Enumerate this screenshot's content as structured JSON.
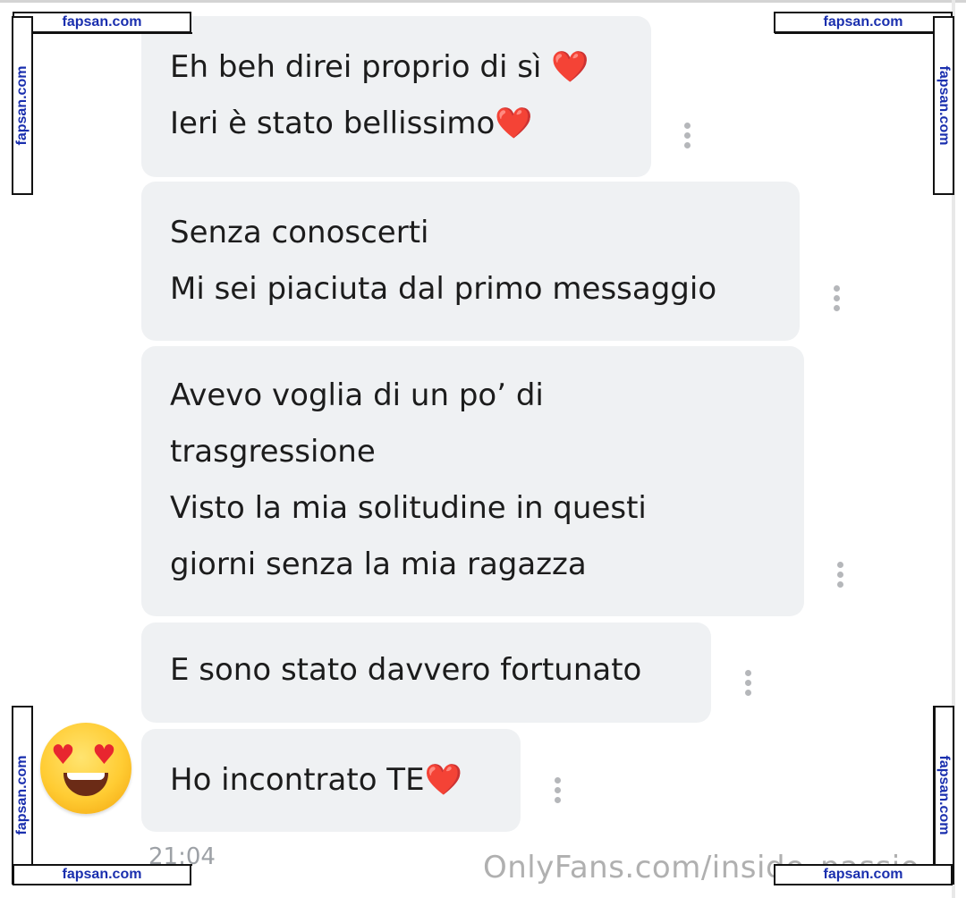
{
  "chat": {
    "messages": [
      {
        "lines": [
          "Eh beh direi proprio di sì",
          "Ieri è stato bellissimo"
        ],
        "hearts": [
          "❤️",
          "❤️"
        ]
      },
      {
        "lines": [
          "Senza conoscerti",
          "Mi sei piaciuta dal primo messaggio"
        ]
      },
      {
        "lines": [
          "Avevo voglia di un po’ di",
          "trasgressione",
          "Visto la mia solitudine in questi",
          "giorni senza la mia ragazza"
        ]
      },
      {
        "lines": [
          "E sono stato davvero fortunato"
        ]
      },
      {
        "lines": [
          "Ho incontrato TE"
        ],
        "hearts": [
          "❤️"
        ]
      }
    ],
    "timestamp": "21:04",
    "avatar_emoji": "smiling-face-with-heart-eyes"
  },
  "overlay": {
    "source_url": "OnlyFans.com/inside_passio",
    "watermark": "fapsan.com"
  },
  "colors": {
    "bubble_bg": "#eff1f3",
    "text": "#1c1c1c",
    "heart": "#e31b23",
    "watermark_text": "#1a2fae"
  }
}
